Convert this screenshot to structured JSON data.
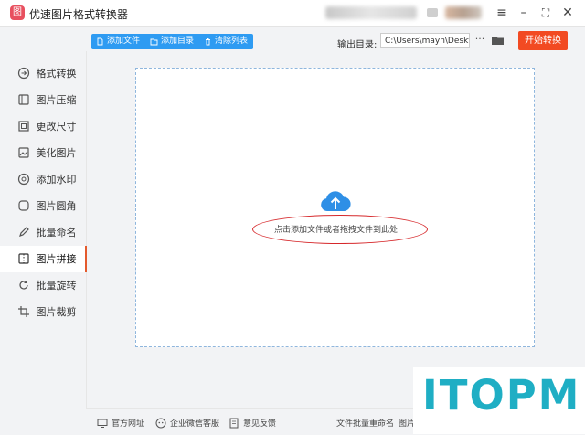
{
  "app": {
    "title": "优速图片格式转换器",
    "logo_glyph": "图"
  },
  "window_controls": {
    "menu": "≡",
    "minimize": "–",
    "maximize": "⛶",
    "close": "✕"
  },
  "sidebar": {
    "items": [
      {
        "label": "格式转换",
        "icon": "format-convert-icon"
      },
      {
        "label": "图片压缩",
        "icon": "image-compress-icon"
      },
      {
        "label": "更改尺寸",
        "icon": "resize-icon"
      },
      {
        "label": "美化图片",
        "icon": "beautify-icon"
      },
      {
        "label": "添加水印",
        "icon": "watermark-icon"
      },
      {
        "label": "图片圆角",
        "icon": "round-corner-icon"
      },
      {
        "label": "批量命名",
        "icon": "rename-icon"
      },
      {
        "label": "图片拼接",
        "icon": "stitch-icon",
        "active": true
      },
      {
        "label": "批量旋转",
        "icon": "rotate-icon"
      },
      {
        "label": "图片裁剪",
        "icon": "crop-icon"
      }
    ]
  },
  "toolbar": {
    "add_file": "添加文件",
    "add_folder": "添加目录",
    "clear_list": "清除列表"
  },
  "output": {
    "label": "输出目录:",
    "path": "C:\\Users\\mayn\\Desktop",
    "more": "···"
  },
  "start_button": "开始转换",
  "dropzone": {
    "hint": "点击添加文件或者拖拽文件到此处"
  },
  "footer": {
    "website": "官方网址",
    "wechat": "企业微信客服",
    "feedback": "意见反馈",
    "batch_rename": "文件批量重命名",
    "more": "图片"
  },
  "watermark": "ITOPM",
  "colors": {
    "accent_blue": "#2e9bf2",
    "start_red": "#f24a22",
    "active_bar": "#e45a2d",
    "annotation_red": "#d6282b",
    "watermark": "#1faec4"
  }
}
